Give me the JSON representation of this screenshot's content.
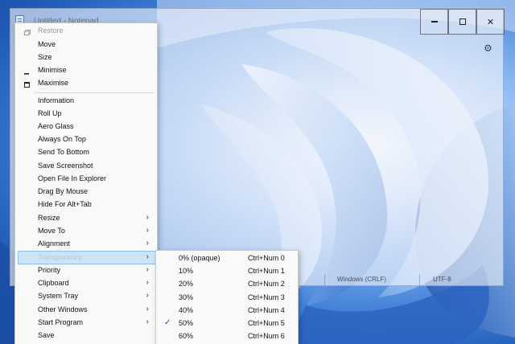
{
  "notepad": {
    "title": "Untitled - Notepad",
    "minimize_glyph": "",
    "close_glyph": "✕",
    "settings_glyph": "⚙",
    "status_eol": "Windows (CRLF)",
    "status_encoding": "UTF-8"
  },
  "menu": {
    "items": [
      {
        "label": "Restore",
        "disabled": true,
        "icon": "restore-icon"
      },
      {
        "label": "Move"
      },
      {
        "label": "Size"
      },
      {
        "label": "Minimise",
        "icon": "minimise-icon"
      },
      {
        "label": "Maximise",
        "icon": "maximise-icon"
      },
      {
        "label": "Information"
      },
      {
        "label": "Roll Up"
      },
      {
        "label": "Aero Glass"
      },
      {
        "label": "Always On Top"
      },
      {
        "label": "Send To Bottom"
      },
      {
        "label": "Save Screenshot"
      },
      {
        "label": "Open File In Explorer"
      },
      {
        "label": "Drag By Mouse"
      },
      {
        "label": "Hide For Alt+Tab"
      },
      {
        "label": "Resize",
        "submenu": true
      },
      {
        "label": "Move To",
        "submenu": true
      },
      {
        "label": "Alignment",
        "submenu": true
      },
      {
        "label": "Transparency",
        "submenu": true,
        "highlighted": true
      },
      {
        "label": "Priority",
        "submenu": true
      },
      {
        "label": "Clipboard",
        "submenu": true
      },
      {
        "label": "System Tray",
        "submenu": true
      },
      {
        "label": "Other Windows",
        "submenu": true
      },
      {
        "label": "Start Program",
        "submenu": true
      },
      {
        "label": "Save"
      }
    ],
    "arrow_glyph": "›"
  },
  "transparency_submenu": {
    "items": [
      {
        "label": "0% (opaque)",
        "shortcut": "Ctrl+Num 0"
      },
      {
        "label": "10%",
        "shortcut": "Ctrl+Num 1"
      },
      {
        "label": "20%",
        "shortcut": "Ctrl+Num 2"
      },
      {
        "label": "30%",
        "shortcut": "Ctrl+Num 3"
      },
      {
        "label": "40%",
        "shortcut": "Ctrl+Num 4"
      },
      {
        "label": "50%",
        "shortcut": "Ctrl+Num 5",
        "checked": true
      },
      {
        "label": "60%",
        "shortcut": "Ctrl+Num 6"
      }
    ],
    "check_glyph": "✓"
  }
}
